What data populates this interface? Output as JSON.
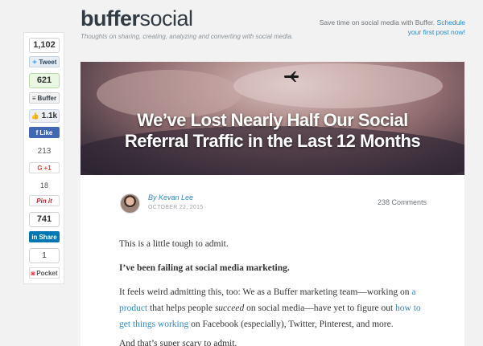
{
  "brand": {
    "part1": "buffer",
    "part2": "social",
    "tagline": "Thoughts on sharing, creating, analyzing and converting with social media."
  },
  "promo": {
    "text": "Save time on social media with Buffer.",
    "link": "Schedule your first post now!"
  },
  "share": {
    "twitter": {
      "count": "1,102",
      "label": "Tweet",
      "color": "#55acee"
    },
    "buffer": {
      "count": "621",
      "label": "Buffer",
      "color": "#323b43"
    },
    "facebook": {
      "count": "1.1k",
      "label": "Like",
      "color": "#3b5998"
    },
    "googleplus": {
      "count": "213",
      "label": "+1",
      "color": "#dd4b39"
    },
    "pinterest": {
      "count": "18",
      "label": "Pin it",
      "color": "#cb2027"
    },
    "linkedin": {
      "count": "741",
      "label": "Share",
      "color": "#0077b5"
    },
    "pocket": {
      "count": "1",
      "label": "Pocket",
      "color": "#ee4056"
    }
  },
  "article": {
    "title_line1": "We’ve Lost Nearly Half Our Social",
    "title_line2": "Referral Traffic in the Last 12 Months",
    "author": "By Kevan Lee",
    "date": "OCTOBER 22, 2015",
    "comments": "238 Comments",
    "p1": "This is a little tough to admit.",
    "p2": "I’ve been failing at social media marketing.",
    "p3_a": "It feels weird admitting this, too: We as a Buffer marketing team—working on ",
    "p3_link1": "a product",
    "p3_b": " that helps people ",
    "p3_em": "succeed",
    "p3_c": " on social media—have yet to figure out ",
    "p3_link2": "how to get things working",
    "p3_d": " on Facebook (especially), Twitter, Pinterest, and more.",
    "p4": "And that’s super scary to admit."
  }
}
